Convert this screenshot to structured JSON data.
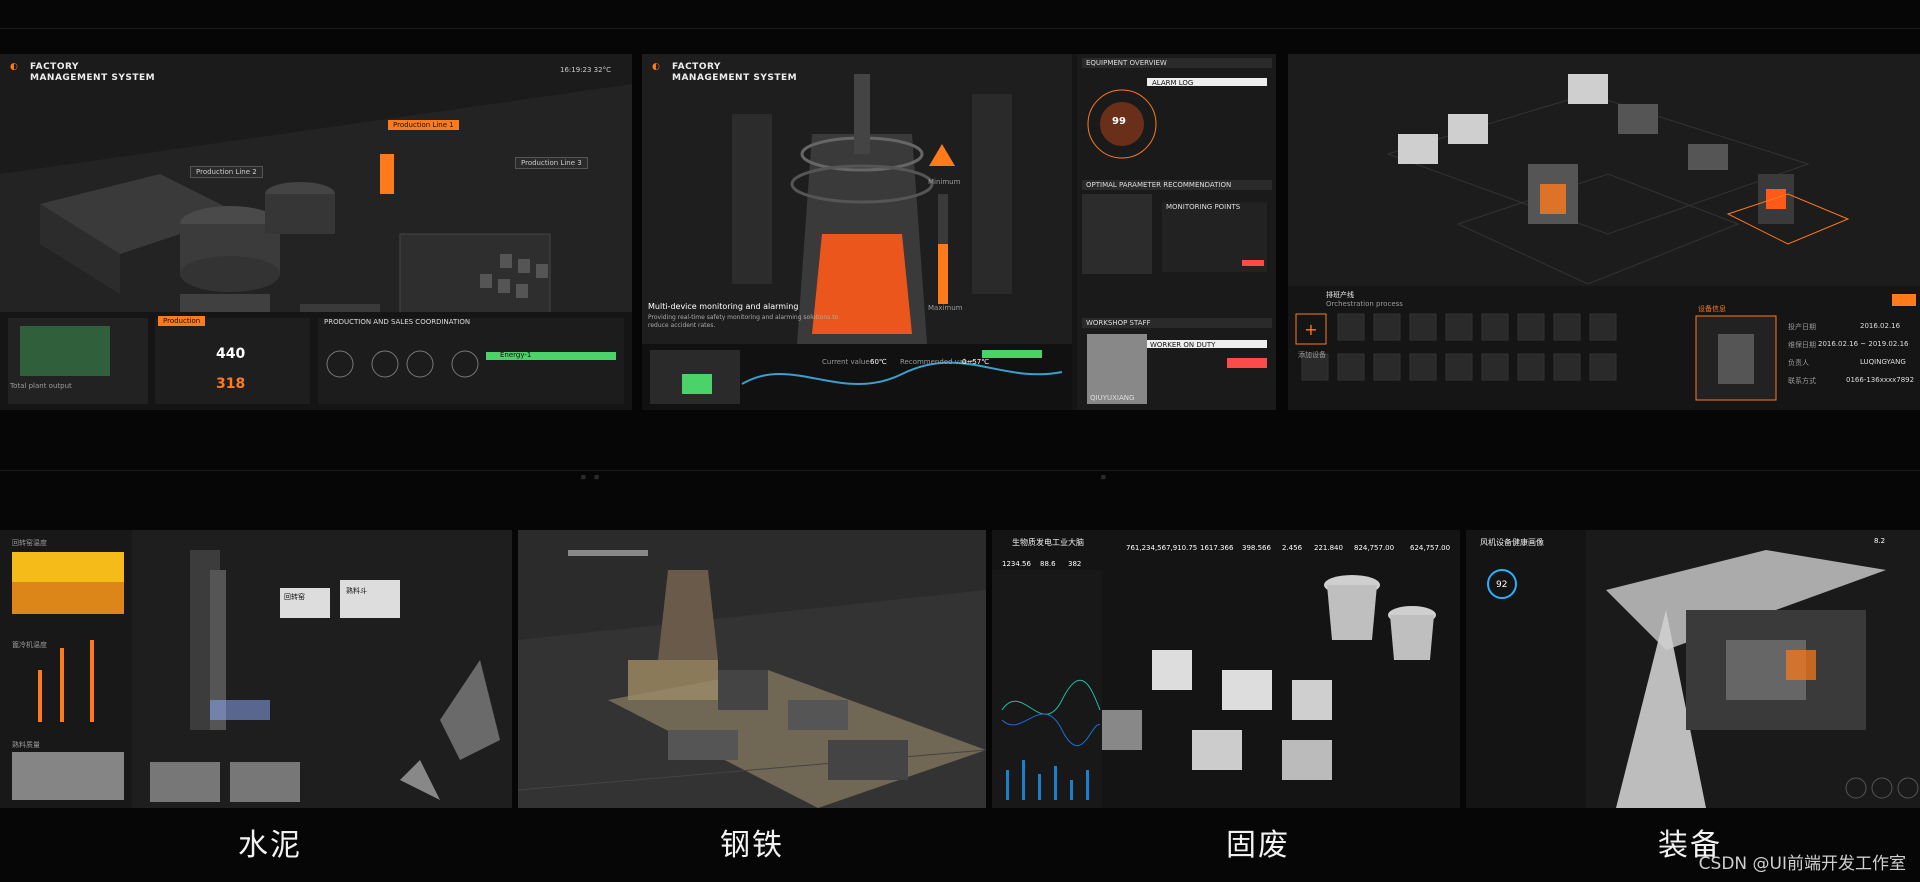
{
  "colors": {
    "accent": "#ff7a1a",
    "bg": "#060606",
    "panel": "#161616",
    "green": "#4bd36a"
  },
  "tile1": {
    "logo_line1": "FACTORY",
    "logo_line2": "MANAGEMENT SYSTEM",
    "clock": "16:19:23  32°C",
    "label_line1": "Production Line 1",
    "label_line2": "Production Line 2",
    "label_line3": "Production Line 3",
    "tab_active": "Production",
    "production_sales": "PRODUCTION AND SALES COORDINATION",
    "total_plant_output": "Total plant output",
    "stat_a": "440",
    "stat_b": "318",
    "green_row": "Energy-1"
  },
  "tile2": {
    "logo_line1": "FACTORY",
    "logo_line2": "MANAGEMENT SYSTEM",
    "banner_title": "Multi-device monitoring and alarming",
    "banner_sub": "Providing real-time safety monitoring and alarming solutions to reduce accident rates.",
    "minimum": "Minimum",
    "maximum": "Maximum",
    "current_value": "Current value",
    "current_val": "60℃",
    "recommended_value": "Recommended value",
    "recommended_val": "0~57℃",
    "equipment_overview": "EQUIPMENT OVERVIEW",
    "alarm_log": "ALARM LOG",
    "gauge_value": "99",
    "optimal_param": "OPTIMAL PARAMETER RECOMMENDATION",
    "monitoring_points": "MONITORING POINTS",
    "workshop_staff": "WORKSHOP STAFF",
    "worker_on_duty": "WORKER ON DUTY",
    "worker_name": "QIUYUXIANG"
  },
  "tile3": {
    "orchestration_title": "排班产线",
    "orchestration_sub": "Orchestration process",
    "device_info": "设备信息",
    "field_1": "投产日期",
    "field_1_val": "2016.02.16",
    "field_2": "维保日期",
    "field_2_val": "2016.02.16 ~ 2019.02.16",
    "field_3": "负责人",
    "field_3_val": "LUQINGYANG",
    "field_4": "联系方式",
    "field_4_val": "0166-136xxxx7892",
    "add_label": "添加设备"
  },
  "tile4": {
    "panel_1": "回转窑温度",
    "panel_2": "篦冷机温度",
    "panel_3": "熟料质量",
    "label_a": "回转窑",
    "label_b": "熟料斗",
    "btn": "水泥"
  },
  "tile6": {
    "title": "生物质发电工业大脑",
    "stat_1": "761,234,567,910.75",
    "stat_2": "1617.366",
    "stat_3": "398.566",
    "stat_4": "2.456",
    "stat_5": "221.840",
    "stat_6": "824,757.00",
    "stat_7": "624,757.00",
    "small_1": "1234.56",
    "small_2": "88.6",
    "small_3": "382"
  },
  "tile7": {
    "title": "风机设备健康画像",
    "score": "92",
    "val_1": "8.2"
  },
  "captions": {
    "c1": "水泥",
    "c2": "钢铁",
    "c3": "固废",
    "c4": "装备"
  },
  "watermark": "CSDN @UI前端开发工作室"
}
